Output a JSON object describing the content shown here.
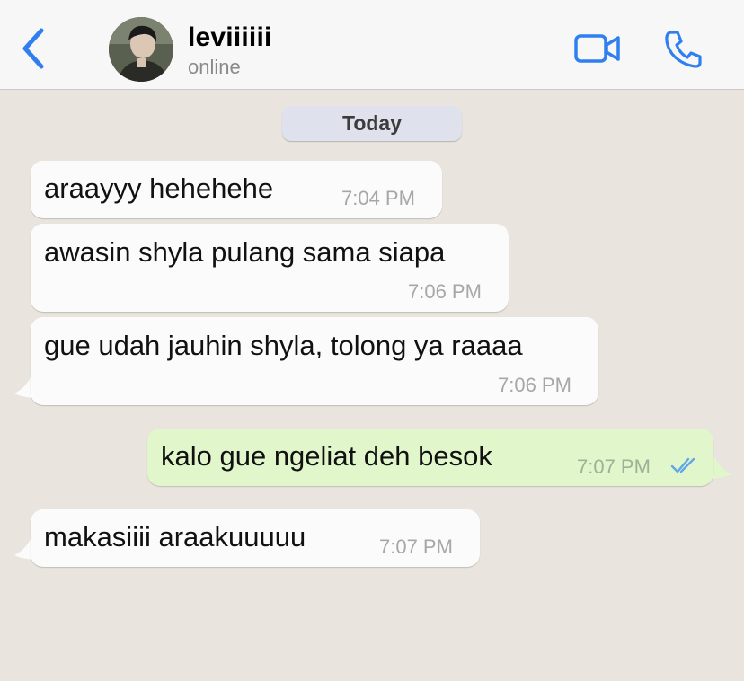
{
  "header": {
    "back_icon": "chevron-left-icon",
    "contact_name": "leviiiiii",
    "status": "online",
    "video_icon": "video-camera-icon",
    "call_icon": "phone-icon",
    "accent_color": "#2f7ff0"
  },
  "date_chip": "Today",
  "messages": [
    {
      "direction": "incoming",
      "text": "araayyy hehehehe",
      "time": "7:04 PM"
    },
    {
      "direction": "incoming",
      "text": "awasin shyla pulang sama siapa",
      "time": "7:06 PM"
    },
    {
      "direction": "incoming",
      "text": "gue udah jauhin shyla, tolong ya raaaa",
      "time": "7:06 PM"
    },
    {
      "direction": "outgoing",
      "text": "kalo gue ngeliat deh besok",
      "time": "7:07 PM",
      "status_icon": "double-check-icon"
    },
    {
      "direction": "incoming",
      "text": "makasiiii araakuuuuu",
      "time": "7:07 PM"
    }
  ],
  "colors": {
    "chat_background": "#e9e5de",
    "incoming_bubble": "#fbfbfb",
    "outgoing_bubble": "#e1f7cb",
    "read_ticks": "#5fa8e8"
  }
}
